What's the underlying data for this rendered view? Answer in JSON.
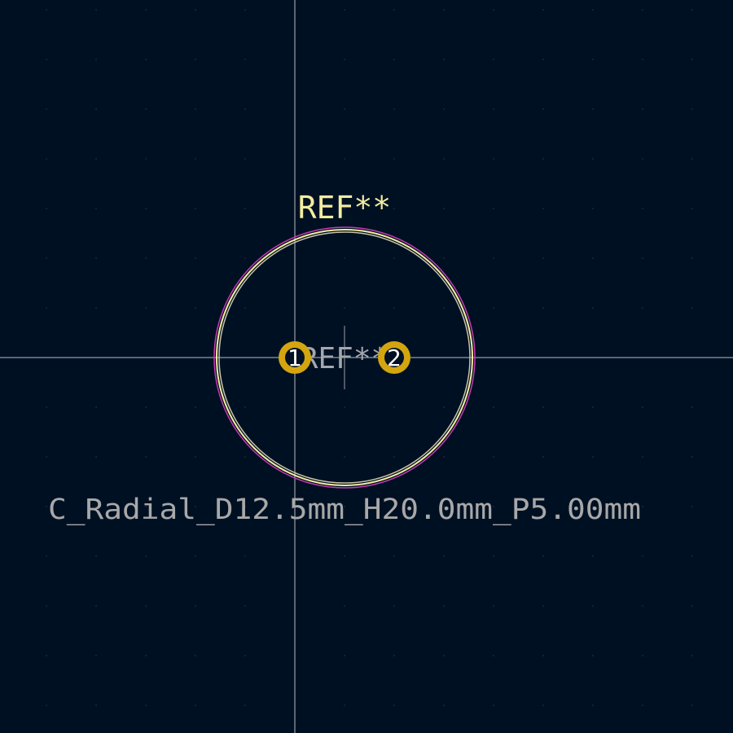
{
  "footprint": {
    "name": "C_Radial_D12.5mm_H20.0mm_P5.00mm",
    "reference_silkscreen": "REF**",
    "reference_fab": "REF**",
    "pads": [
      {
        "number": "1"
      },
      {
        "number": "2"
      }
    ]
  },
  "colors": {
    "background": "#001023",
    "grid_dot": "#4a5563",
    "crosshair": "#b8bcc2",
    "silkscreen": "#f2eda1",
    "fab_outline": "#c8c4a8",
    "courtyard": "#c83bb4",
    "pad": "#d4a50f",
    "pad_hole": "#001023",
    "pad_number": "#ffffff",
    "fab_text": "#a4a8ad",
    "value_text": "#a8a8a8",
    "anchor": "#9aa0a6"
  }
}
